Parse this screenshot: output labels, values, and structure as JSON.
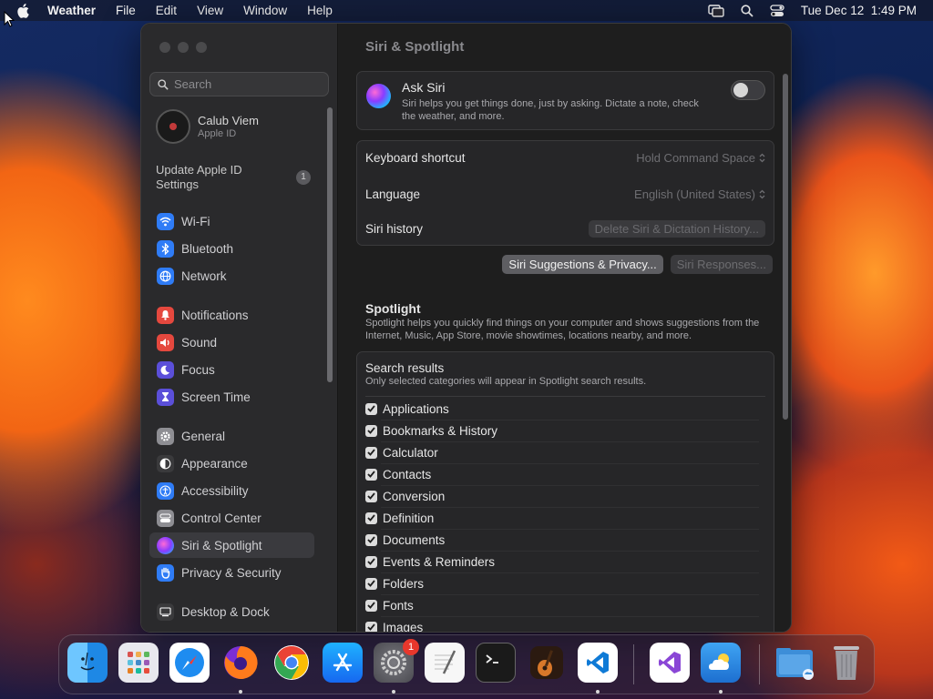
{
  "menubar": {
    "app_name": "Weather",
    "menus": [
      "File",
      "Edit",
      "View",
      "Window",
      "Help"
    ],
    "datetime": "Tue Dec 12  1:49 PM"
  },
  "sidebar": {
    "search_placeholder": "Search",
    "profile": {
      "name": "Calub Viem",
      "subtitle": "Apple ID"
    },
    "update": {
      "label": "Update Apple ID Settings",
      "badge": "1"
    },
    "items": [
      {
        "label": "Wi-Fi",
        "icon": "wifi-icon",
        "color": "#2f7cf6"
      },
      {
        "label": "Bluetooth",
        "icon": "bluetooth-icon",
        "color": "#2f7cf6"
      },
      {
        "label": "Network",
        "icon": "network-icon",
        "color": "#2f7cf6"
      },
      {
        "label": "Notifications",
        "icon": "bell-icon",
        "color": "#e5483e"
      },
      {
        "label": "Sound",
        "icon": "speaker-icon",
        "color": "#e5483e"
      },
      {
        "label": "Focus",
        "icon": "moon-icon",
        "color": "#5b4fd9"
      },
      {
        "label": "Screen Time",
        "icon": "hourglass-icon",
        "color": "#5b4fd9"
      },
      {
        "label": "General",
        "icon": "gear-icon",
        "color": "#8e8e93"
      },
      {
        "label": "Appearance",
        "icon": "appearance-icon",
        "color": "#3a3a3c"
      },
      {
        "label": "Accessibility",
        "icon": "accessibility-icon",
        "color": "#2f7cf6"
      },
      {
        "label": "Control Center",
        "icon": "control-center-icon",
        "color": "#8e8e93"
      },
      {
        "label": "Siri & Spotlight",
        "icon": "siri-icon",
        "color": "#b03ad9"
      },
      {
        "label": "Privacy & Security",
        "icon": "hand-icon",
        "color": "#2f7cf6"
      },
      {
        "label": "Desktop & Dock",
        "icon": "desktop-icon",
        "color": "#3a3a3c"
      }
    ],
    "selected": "Siri & Spotlight"
  },
  "content": {
    "title": "Siri & Spotlight",
    "ask_siri": {
      "title": "Ask Siri",
      "description": "Siri helps you get things done, just by asking. Dictate a note, check the weather, and more.",
      "enabled": false
    },
    "keyboard_shortcut": {
      "label": "Keyboard shortcut",
      "value": "Hold Command Space"
    },
    "language": {
      "label": "Language",
      "value": "English (United States)"
    },
    "siri_history": {
      "label": "Siri history",
      "button": "Delete Siri & Dictation History..."
    },
    "buttons": {
      "suggestions": "Siri Suggestions & Privacy...",
      "responses": "Siri Responses..."
    },
    "spotlight": {
      "title": "Spotlight",
      "description": "Spotlight helps you quickly find things on your computer and shows suggestions from the Internet, Music, App Store, movie showtimes, locations nearby, and more."
    },
    "search_results": {
      "title": "Search results",
      "description": "Only selected categories will appear in Spotlight search results.",
      "categories": [
        {
          "label": "Applications",
          "checked": true
        },
        {
          "label": "Bookmarks & History",
          "checked": true
        },
        {
          "label": "Calculator",
          "checked": true
        },
        {
          "label": "Contacts",
          "checked": true
        },
        {
          "label": "Conversion",
          "checked": true
        },
        {
          "label": "Definition",
          "checked": true
        },
        {
          "label": "Documents",
          "checked": true
        },
        {
          "label": "Events & Reminders",
          "checked": true
        },
        {
          "label": "Folders",
          "checked": true
        },
        {
          "label": "Fonts",
          "checked": true
        },
        {
          "label": "Images",
          "checked": true
        }
      ]
    }
  },
  "dock": {
    "apps": [
      {
        "name": "finder-icon",
        "running": true
      },
      {
        "name": "launchpad-icon",
        "running": false
      },
      {
        "name": "safari-icon",
        "running": false
      },
      {
        "name": "firefox-icon",
        "running": true
      },
      {
        "name": "chrome-icon",
        "running": false
      },
      {
        "name": "app-store-icon",
        "running": false
      },
      {
        "name": "system-settings-icon",
        "running": true,
        "badge": "1"
      },
      {
        "name": "textedit-icon",
        "running": false
      },
      {
        "name": "terminal-icon",
        "running": false
      },
      {
        "name": "garageband-icon",
        "running": false
      },
      {
        "name": "vscode-icon",
        "running": true
      },
      {
        "name": "visual-studio-icon",
        "running": false
      },
      {
        "name": "weather-icon",
        "running": true
      },
      {
        "name": "downloads-folder-icon",
        "running": false
      },
      {
        "name": "trash-icon",
        "running": false
      }
    ]
  }
}
